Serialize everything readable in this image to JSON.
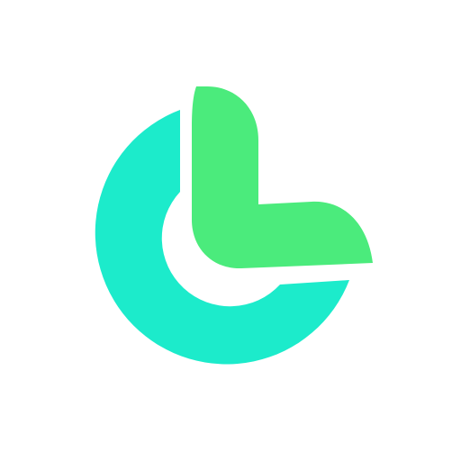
{
  "logo": {
    "icon": "c-l-monogram-logo-icon",
    "colors": {
      "background": "#ffffff",
      "c_shape": "#1CEBCB",
      "l_shape": "#4BEB7C"
    }
  }
}
